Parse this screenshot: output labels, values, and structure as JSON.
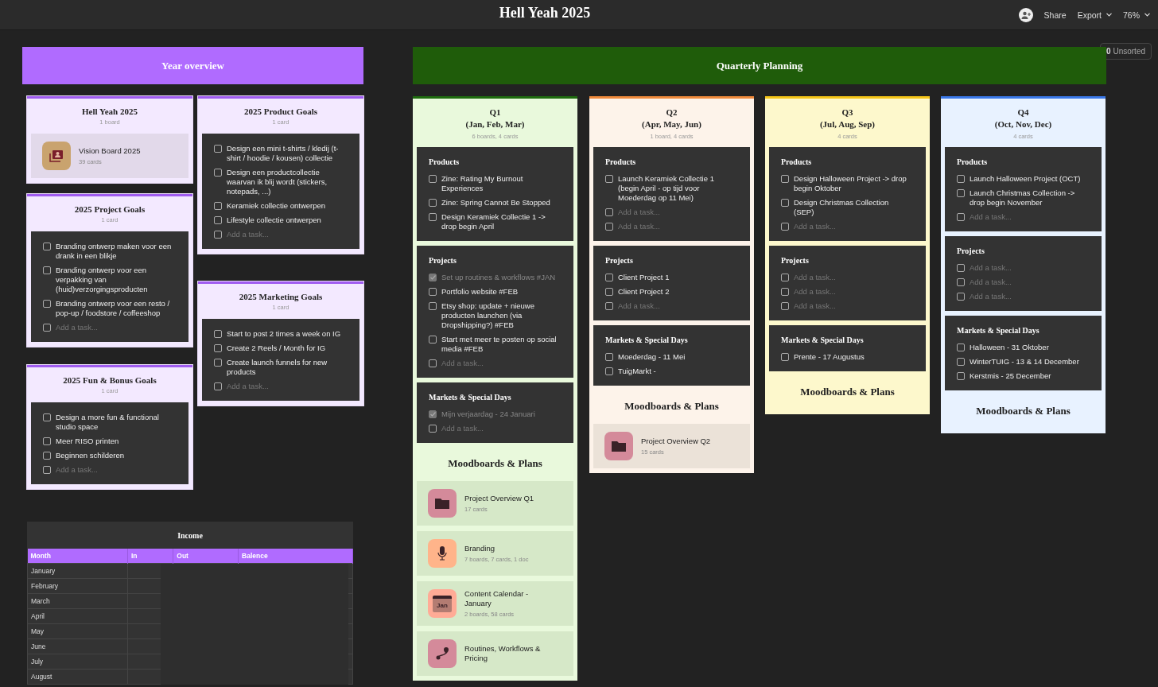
{
  "topbar": {
    "title": "Hell Yeah 2025",
    "actions": [
      {
        "kind": "share",
        "label": "Share"
      },
      {
        "kind": "dropdown",
        "label": "Export"
      },
      {
        "kind": "dropdown",
        "label": "76%"
      }
    ]
  },
  "unsorted": {
    "count": "0",
    "label": "Unsorted"
  },
  "year_overview": {
    "title": "Year overview",
    "cards": [
      {
        "title": "Hell Yeah 2025",
        "meta": "1 board",
        "boards": [
          {
            "title": "Vision Board 2025",
            "meta": "39 cards",
            "kind": "portrait",
            "color": "#c9a36e"
          }
        ]
      },
      {
        "title": "2025 Product Goals",
        "meta": "1 card",
        "tasks": [
          {
            "kind": "task",
            "text": "Design een mini t-shirts / kledij (t-shirt / hoodie / kousen) collectie",
            "checked": false
          },
          {
            "kind": "task",
            "text": "Design een productcollectie waarvan ik blij wordt (stickers, notepads, ...)",
            "checked": false
          },
          {
            "kind": "task",
            "text": "Keramiek collectie ontwerpen",
            "checked": false
          },
          {
            "kind": "task",
            "text": "Lifestyle collectie ontwerpen",
            "checked": false
          },
          {
            "kind": "add",
            "placeholder": "Add a task...",
            "checked": false
          }
        ]
      },
      {
        "title": "2025 Project Goals",
        "meta": "1 card",
        "tasks": [
          {
            "kind": "task",
            "text": "Branding ontwerp maken voor een drank in een blikje",
            "checked": false
          },
          {
            "kind": "task",
            "text": "Branding ontwerp voor een verpakking van (huid)verzorgingsproducten",
            "checked": false
          },
          {
            "kind": "task",
            "text": "Branding ontwerp voor een resto / pop-up / foodstore / coffeeshop",
            "checked": false
          },
          {
            "kind": "add",
            "placeholder": "Add a task...",
            "checked": false
          }
        ]
      },
      {
        "title": "2025 Marketing Goals",
        "meta": "1 card",
        "tasks": [
          {
            "kind": "task",
            "text": "Start to post 2 times a week on IG",
            "checked": false
          },
          {
            "kind": "task",
            "text": "Create 2 Reels / Month for IG",
            "checked": false
          },
          {
            "kind": "task",
            "text": "Create launch funnels for new products",
            "checked": false
          },
          {
            "kind": "add",
            "placeholder": "Add a task...",
            "checked": false
          }
        ]
      },
      {
        "title": "2025 Fun & Bonus Goals",
        "meta": "1 card",
        "tasks": [
          {
            "kind": "task",
            "text": "Design a more fun & functional studio space",
            "checked": false
          },
          {
            "kind": "task",
            "text": "Meer RISO printen",
            "checked": false
          },
          {
            "kind": "task",
            "text": "Beginnen schilderen",
            "checked": false
          },
          {
            "kind": "add",
            "placeholder": "Add a task...",
            "checked": false
          }
        ]
      }
    ]
  },
  "quarterly_planning": {
    "title": "Quarterly Planning",
    "columns": [
      {
        "title": "Q1",
        "months": "(Jan, Feb, Mar)",
        "meta": "6 boards, 4 cards",
        "color": "#1f6b0f",
        "sections": [
          {
            "title": "Products",
            "tasks": [
              {
                "kind": "task",
                "text": "Zine: Rating My Burnout Experiences",
                "checked": false
              },
              {
                "kind": "task",
                "text": "Zine: Spring Cannot Be Stopped",
                "checked": false
              },
              {
                "kind": "task",
                "text": "Design Keramiek Collectie 1 -> drop begin April",
                "checked": false
              }
            ]
          },
          {
            "title": "Projects",
            "tasks": [
              {
                "kind": "task",
                "text": "Set up routines & workflows #JAN",
                "checked": true
              },
              {
                "kind": "task",
                "text": "Portfolio website #FEB",
                "checked": false
              },
              {
                "kind": "task",
                "text": "Etsy shop: update + nieuwe producten launchen (via Dropshipping?) #FEB",
                "checked": false
              },
              {
                "kind": "task",
                "text": "Start met meer te posten op social media #FEB",
                "checked": false
              },
              {
                "kind": "add",
                "placeholder": "Add a task...",
                "checked": false
              }
            ]
          },
          {
            "title": "Markets & Special Days",
            "tasks": [
              {
                "kind": "task",
                "text": "Mijn verjaardag - 24 Januari",
                "checked": true
              },
              {
                "kind": "add",
                "placeholder": "Add a task...",
                "checked": false
              }
            ]
          }
        ],
        "boards_title": "Moodboards & Plans",
        "boards": [
          {
            "title": "Project Overview Q1",
            "meta": "17 cards",
            "kind": "folder",
            "color": "#d48a9a"
          },
          {
            "title": "Branding",
            "meta": "7 boards, 7 cards, 1 doc",
            "kind": "microphone",
            "color": "#ffb48a"
          },
          {
            "title": "Content Calendar - January",
            "meta": "2 boards, 58 cards",
            "kind": "calendar",
            "icon_label": "Jan",
            "color": "#ffab96"
          },
          {
            "title": "Routines, Workflows & Pricing",
            "kind": "route",
            "color": "#d48a9a"
          }
        ]
      },
      {
        "title": "Q2",
        "months": "(Apr, May, Jun)",
        "meta": "1 board, 4 cards",
        "color": "#f08a3c",
        "sections": [
          {
            "title": "Products",
            "tasks": [
              {
                "kind": "task",
                "text": "Launch Keramiek Collectie 1 (begin April - op tijd voor Moederdag op 11 Mei)",
                "checked": false
              },
              {
                "kind": "add",
                "placeholder": "Add a task...",
                "checked": false
              },
              {
                "kind": "add",
                "placeholder": "Add a task...",
                "checked": false
              }
            ]
          },
          {
            "title": "Projects",
            "tasks": [
              {
                "kind": "task",
                "text": "Client Project 1",
                "checked": false
              },
              {
                "kind": "task",
                "text": "Client Project 2",
                "checked": false
              },
              {
                "kind": "add",
                "placeholder": "Add a task...",
                "checked": false
              }
            ]
          },
          {
            "title": "Markets & Special Days",
            "tasks": [
              {
                "kind": "task",
                "text": "Moederdag - 11 Mei",
                "checked": false
              },
              {
                "kind": "task",
                "text": "TuigMarkt -",
                "checked": false
              }
            ]
          }
        ],
        "boards_title": "Moodboards & Plans",
        "boards": [
          {
            "title": "Project Overview Q2",
            "meta": "15 cards",
            "kind": "folder",
            "color": "#d48a9a"
          }
        ]
      },
      {
        "title": "Q3",
        "months": "(Jul, Aug, Sep)",
        "meta": "4 cards",
        "color": "#f5c518",
        "sections": [
          {
            "title": "Products",
            "tasks": [
              {
                "kind": "task",
                "text": "Design Halloween Project -> drop begin Oktober",
                "checked": false
              },
              {
                "kind": "task",
                "text": "Design Christmas Collection (SEP)",
                "checked": false
              },
              {
                "kind": "add",
                "placeholder": "Add a task...",
                "checked": false
              }
            ]
          },
          {
            "title": "Projects",
            "tasks": [
              {
                "kind": "add",
                "placeholder": "Add a task...",
                "checked": false
              },
              {
                "kind": "add",
                "placeholder": "Add a task...",
                "checked": false
              },
              {
                "kind": "add",
                "placeholder": "Add a task...",
                "checked": false
              }
            ]
          },
          {
            "title": "Markets & Special Days",
            "tasks": [
              {
                "kind": "task",
                "text": "Prente - 17 Augustus",
                "checked": false
              }
            ]
          }
        ],
        "boards_title": "Moodboards & Plans"
      },
      {
        "title": "Q4",
        "months": "(Oct, Nov, Dec)",
        "meta": "4 cards",
        "color": "#3a78e8",
        "sections": [
          {
            "title": "Products",
            "tasks": [
              {
                "kind": "task",
                "text": "Launch Halloween Project (OCT)",
                "checked": false
              },
              {
                "kind": "task",
                "text": "Launch Christmas Collection -> drop begin November",
                "checked": false
              },
              {
                "kind": "add",
                "placeholder": "Add a task...",
                "checked": false
              }
            ]
          },
          {
            "title": "Projects",
            "tasks": [
              {
                "kind": "add",
                "placeholder": "Add a task...",
                "checked": false
              },
              {
                "kind": "add",
                "placeholder": "Add a task...",
                "checked": false
              },
              {
                "kind": "add",
                "placeholder": "Add a task...",
                "checked": false
              }
            ]
          },
          {
            "title": "Markets & Special Days",
            "tasks": [
              {
                "kind": "task",
                "text": "Halloween - 31 Oktober",
                "checked": false
              },
              {
                "kind": "task",
                "text": "WinterTUIG - 13 & 14 December",
                "checked": false
              },
              {
                "kind": "task",
                "text": "Kerstmis - 25 December",
                "checked": false
              }
            ]
          }
        ],
        "boards_title": "Moodboards & Plans"
      }
    ]
  },
  "income": {
    "title": "Income",
    "columns": [
      "Month",
      "In",
      "Out",
      "Balence"
    ],
    "rows": [
      "January",
      "February",
      "March",
      "April",
      "May",
      "June",
      "July",
      "August"
    ]
  }
}
